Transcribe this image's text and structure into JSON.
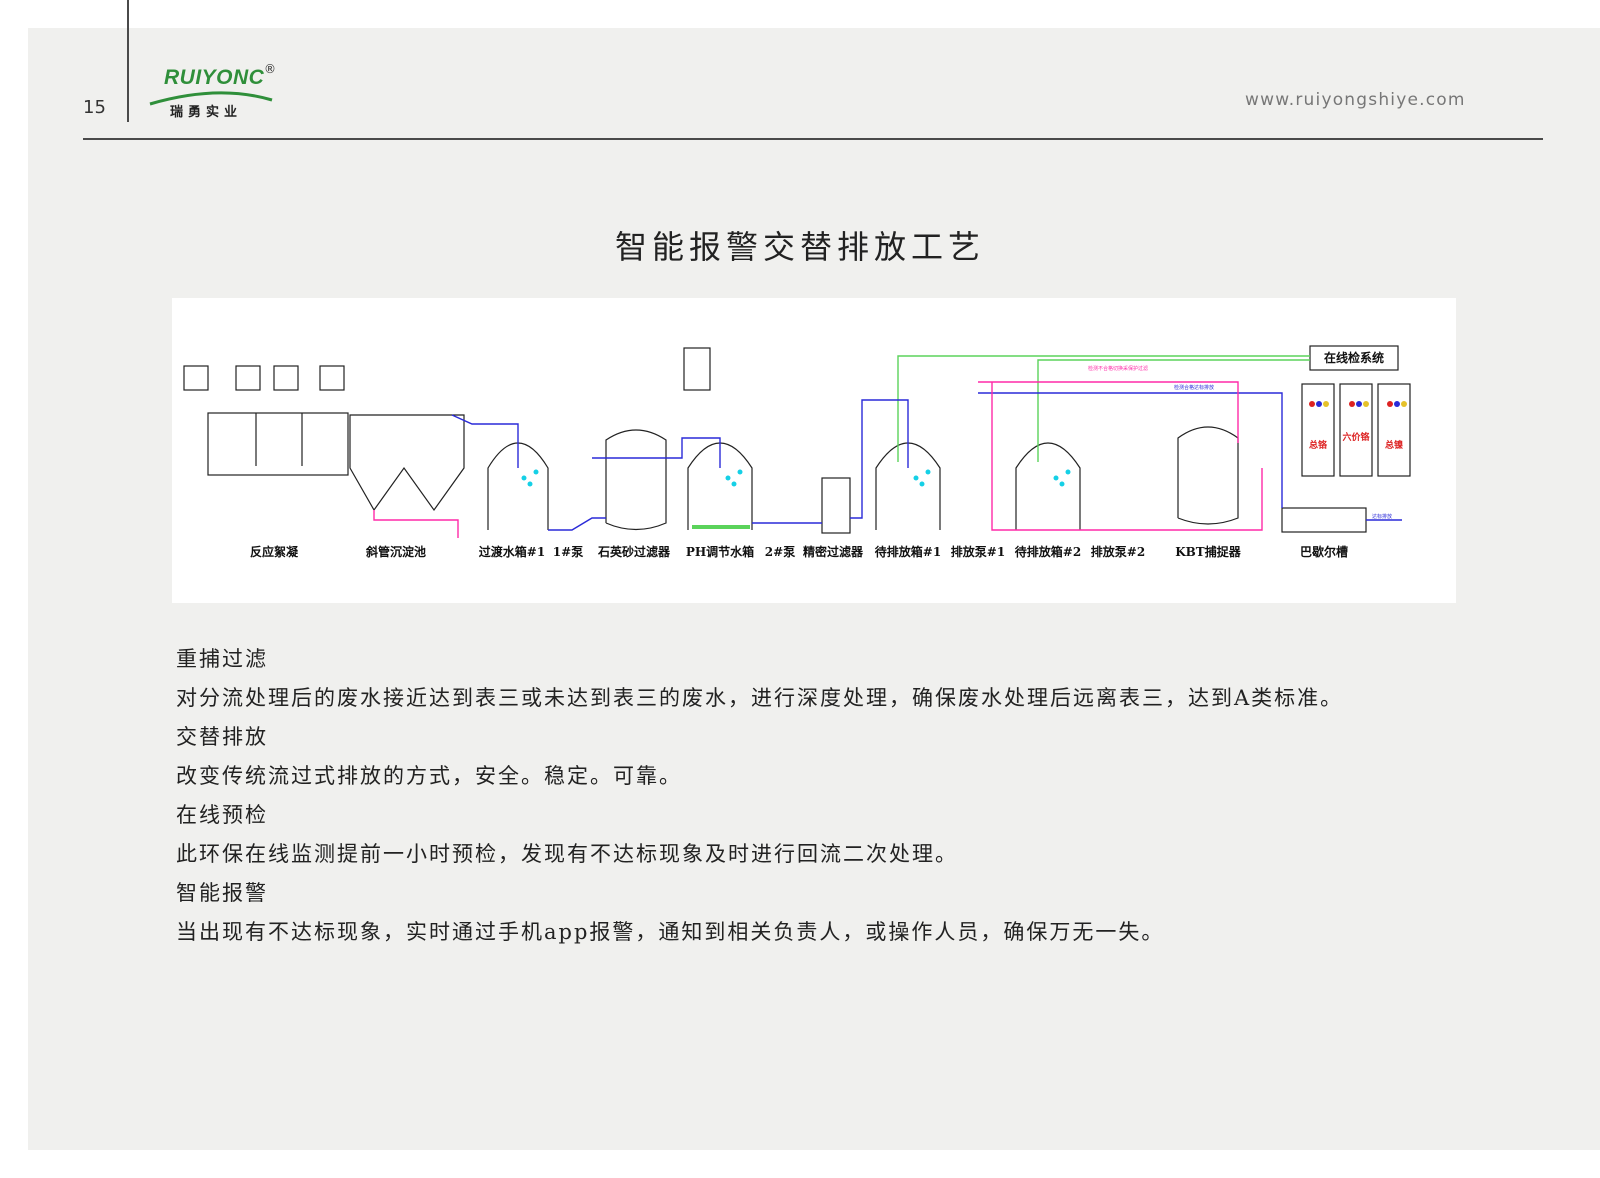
{
  "header": {
    "page_number": "15",
    "logo_text": "RUIYONC",
    "logo_registered": "®",
    "logo_subtitle": "瑞勇实业",
    "website": "www.ruiyongshiye.com"
  },
  "title": "智能报警交替排放工艺",
  "diagram": {
    "online_system": "在线检系统",
    "flow_note_top": "检测不合格切换采保护过滤",
    "flow_note_mid": "检测合格达标排放",
    "discharge_note": "达标排放",
    "alarm_labels": [
      "总铬",
      "六价铬",
      "总镍"
    ],
    "equipment_labels": [
      "反应絮凝",
      "斜管沉淀池",
      "过渡水箱#1",
      "1#泵",
      "石英砂过滤器",
      "PH调节水箱",
      "2#泵",
      "精密过滤器",
      "待排放箱#1",
      "排放泵#1",
      "待排放箱#2",
      "排放泵#2",
      "KBT捕捉器",
      "巴歇尔槽"
    ]
  },
  "content": {
    "items": [
      {
        "heading": "重捕过滤",
        "text": "对分流处理后的废水接近达到表三或未达到表三的废水，进行深度处理，确保废水处理后远离表三，达到A类标准。"
      },
      {
        "heading": "交替排放",
        "text": "改变传统流过式排放的方式，安全。稳定。可靠。"
      },
      {
        "heading": "在线预检",
        "text": "此环保在线监测提前一小时预检，发现有不达标现象及时进行回流二次处理。"
      },
      {
        "heading": "智能报警",
        "text": "当出现有不达标现象，实时通过手机app报警，通知到相关负责人，或操作人员，确保万无一失。"
      }
    ]
  }
}
